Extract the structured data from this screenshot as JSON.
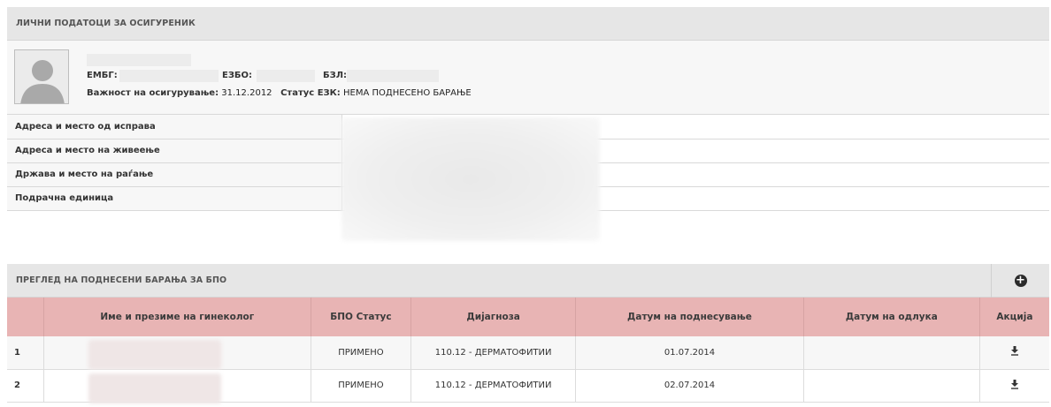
{
  "personal": {
    "title": "ЛИЧНИ ПОДАТОЦИ ЗА ОСИГУРЕНИК",
    "embg_label": "ЕМБГ:",
    "ezbo_label": "ЕЗБО:",
    "bzl_label": "БЗЛ:",
    "validity_label": "Важност на осигурување:",
    "validity_value": "31.12.2012",
    "status_label": "Статус ЕЗК:",
    "status_value": "НЕМА ПОДНЕСЕНО БАРАЊЕ",
    "rows": [
      {
        "label": "Адреса и место од исправа"
      },
      {
        "label": "Адреса и место на живеење"
      },
      {
        "label": "Држава и место на раѓање"
      },
      {
        "label": "Подрачна единица"
      }
    ]
  },
  "requests": {
    "title": "ПРЕГЛЕД НА ПОДНЕСЕНИ БАРАЊА ЗА БПО",
    "add_icon": "plus-circle-icon",
    "columns": [
      "",
      "Име и презиме на гинеколог",
      "БПО Статус",
      "Дијагноза",
      "Датум на поднесување",
      "Датум на одлука",
      "Акција"
    ],
    "rows": [
      {
        "num": "1",
        "status": "ПРИМЕНО",
        "diagnosis": "110.12 - ДЕРМАТОФИТИИ",
        "submitted": "01.07.2014",
        "decision": "",
        "action_icon": "download-icon"
      },
      {
        "num": "2",
        "status": "ПРИМЕНО",
        "diagnosis": "110.12 - ДЕРМАТОФИТИИ",
        "submitted": "02.07.2014",
        "decision": "",
        "action_icon": "download-icon"
      }
    ]
  },
  "colors": {
    "header_bg": "#e6e6e6",
    "table_header_bg": "#e8b4b4"
  }
}
